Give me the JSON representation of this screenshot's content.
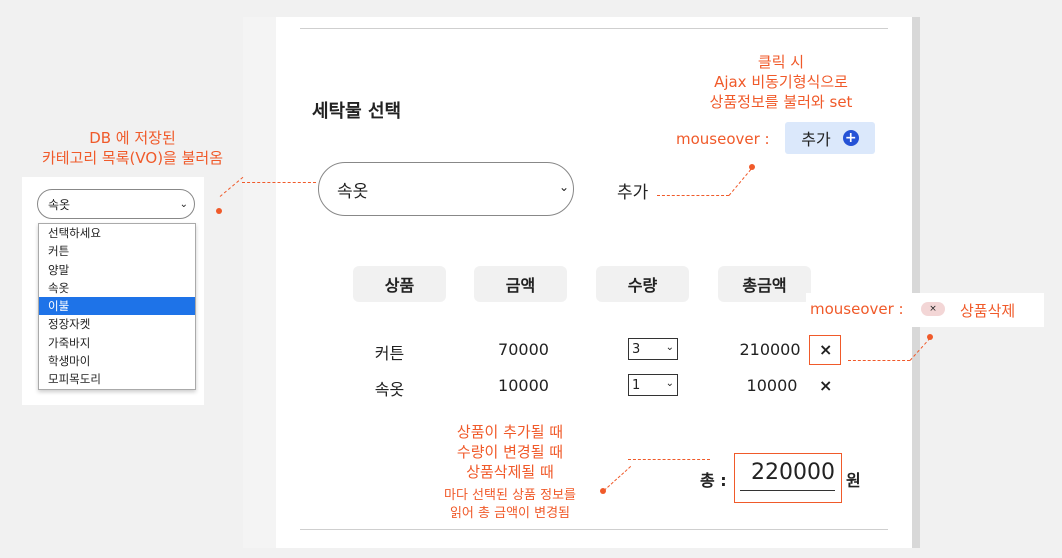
{
  "colors": {
    "accent": "#f05a2a",
    "selected": "#1e73e8",
    "add_button_bg": "#dbe8fb",
    "plus_icon": "#2552d6"
  },
  "left_demo": {
    "select_value": "속옷",
    "options": [
      "선택하세요",
      "커튼",
      "양말",
      "속옷",
      "이불",
      "정장자켓",
      "가죽바지",
      "학생마이",
      "모피목도리"
    ],
    "selected_index": 4
  },
  "main": {
    "title": "세탁물 선택",
    "select_value": "속옷",
    "add_label": "추가",
    "headers": [
      "상품",
      "금액",
      "수량",
      "총금액"
    ],
    "rows": [
      {
        "name": "커튼",
        "price": "70000",
        "qty": "3",
        "total": "210000",
        "delete": "×"
      },
      {
        "name": "속옷",
        "price": "10000",
        "qty": "1",
        "total": "10000",
        "delete": "×"
      }
    ],
    "total_label": "총 :",
    "total_value": "220000",
    "total_unit": "원"
  },
  "annotations": {
    "left_line1": "DB 에 저장된",
    "left_line2": "카테고리 목록(VO)을 불러옴",
    "top_line1": "클릭 시",
    "top_line2": "Ajax 비동기형식으로",
    "top_line3": "상품정보를 불러와 set",
    "mouseover_label1": "mouseover :",
    "add_button_label": "추가",
    "add_button_icon": "+",
    "mouseover_label2": "mouseover :",
    "x_pill": "×",
    "delete_label": "상품삭제",
    "bottom_line1": "상품이 추가될 때",
    "bottom_line2": "수량이 변경될 때",
    "bottom_line3": "상품삭제될 때",
    "bottom_line4": "마다 선택된 상품 정보를",
    "bottom_line5": "읽어 총 금액이 변경됨"
  }
}
